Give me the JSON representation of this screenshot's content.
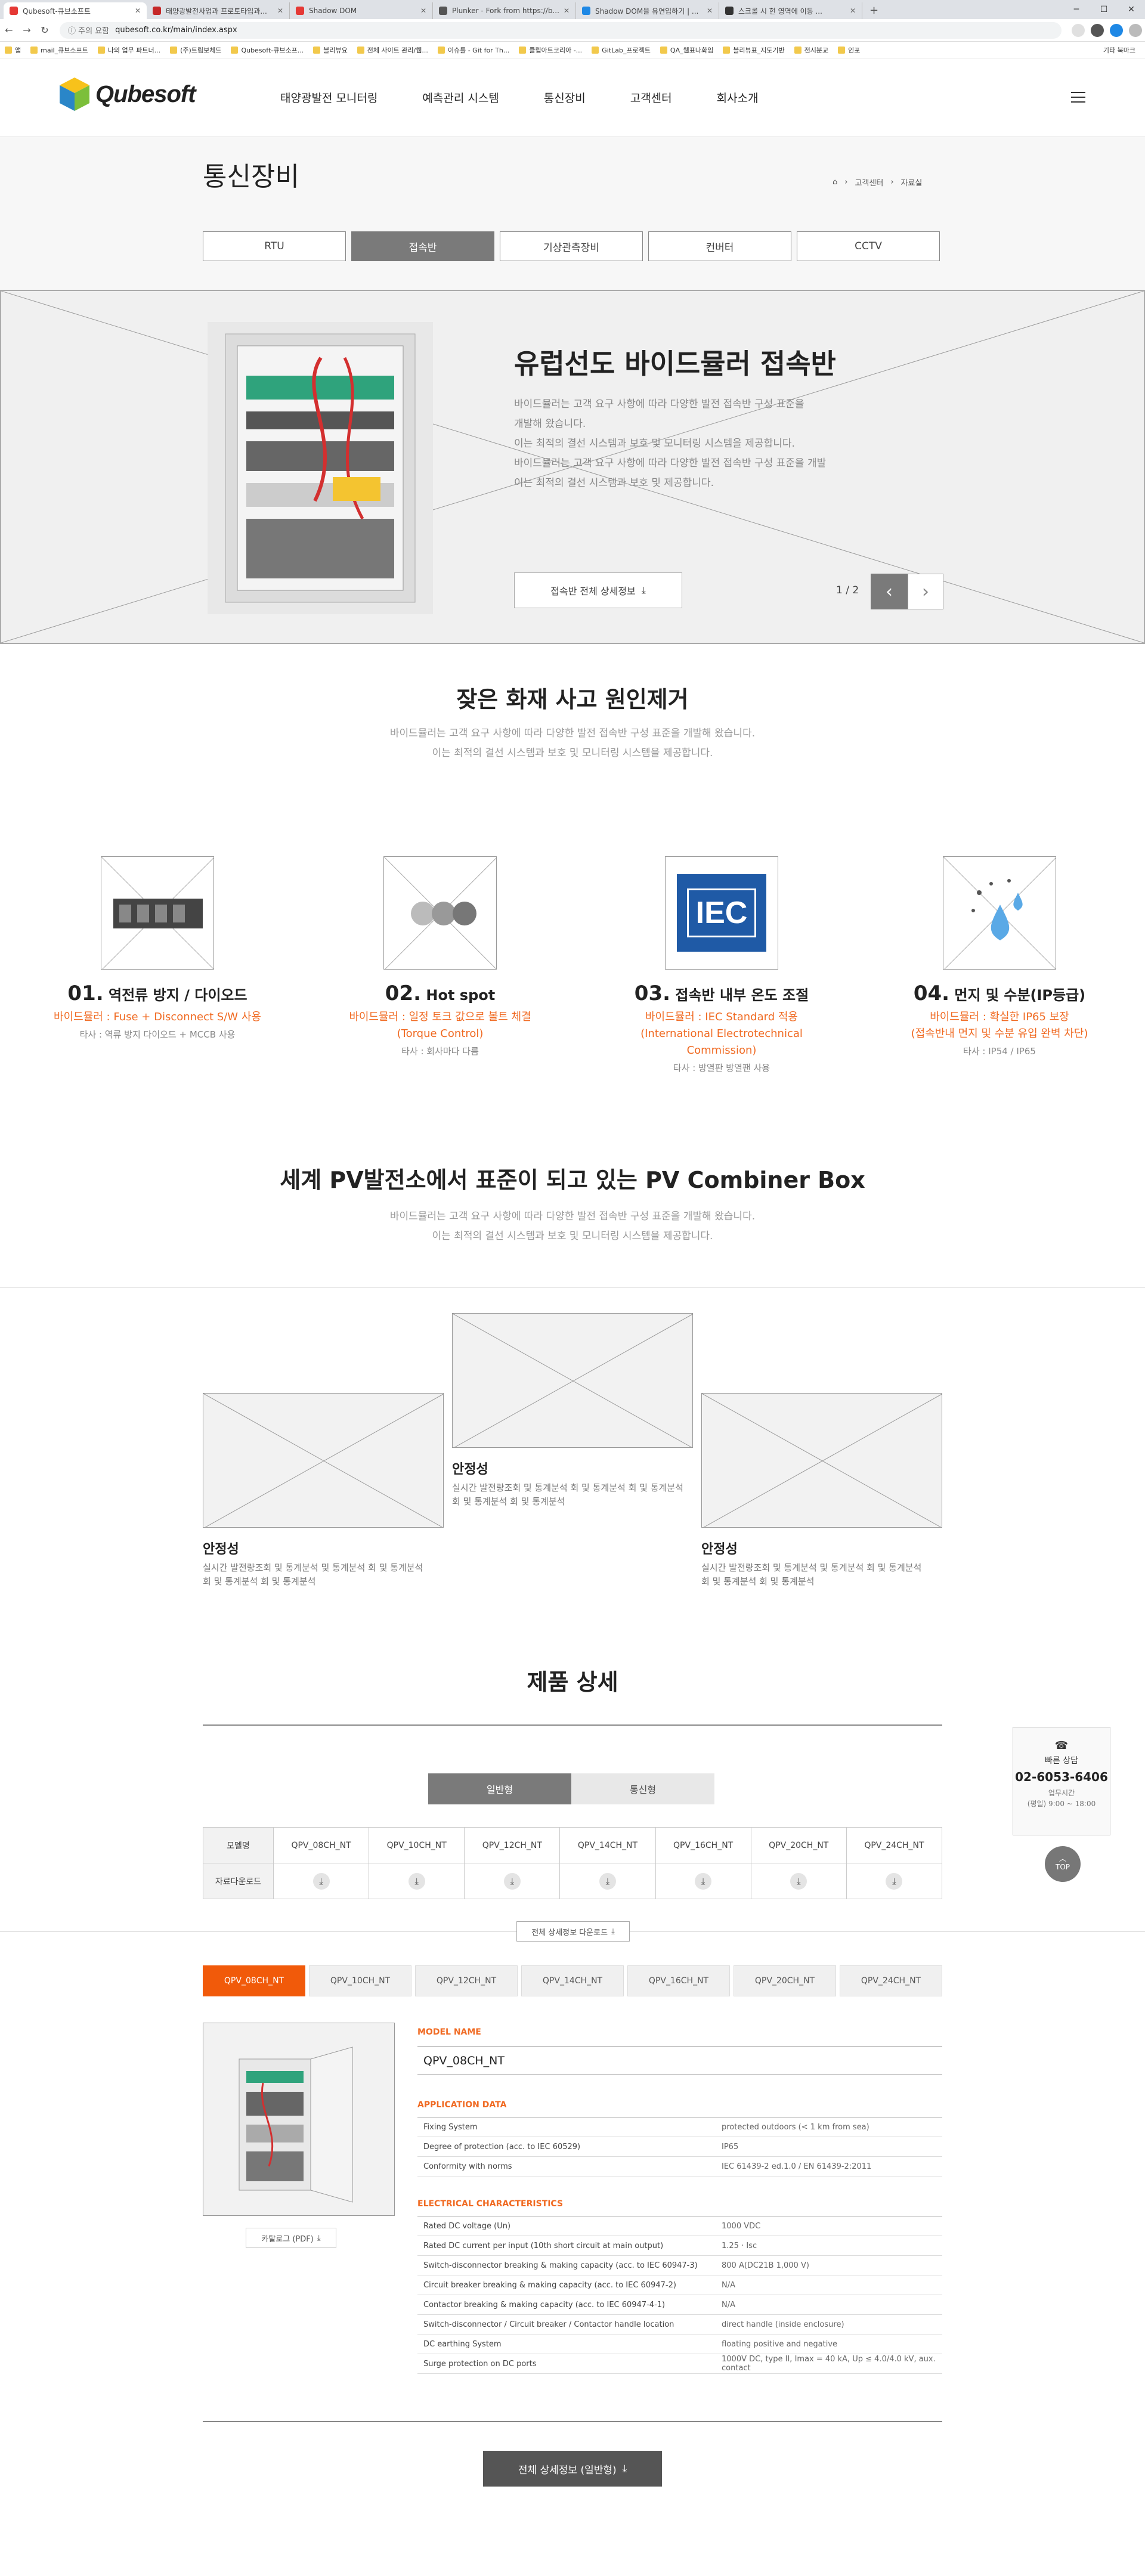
{
  "browser": {
    "tabs": [
      {
        "label": "Qubesoft-큐브소프트",
        "active": true,
        "color": "#e53935"
      },
      {
        "label": "태양광발전사업과 프로토타입과...",
        "active": false,
        "color": "#c62828"
      },
      {
        "label": "Shadow DOM",
        "active": false,
        "color": "#e53935"
      },
      {
        "label": "Plunker - Fork from https://b...",
        "active": false,
        "color": "#555555"
      },
      {
        "label": "Shadow DOM을 유연입하기 | ...",
        "active": false,
        "color": "#1e88e5"
      },
      {
        "label": "스크롤 시 현 영역에 이동 ...",
        "active": false,
        "color": "#333333"
      }
    ],
    "new_tab": "+",
    "security": "주의 요함",
    "url": "qubesoft.co.kr/main/index.aspx",
    "bookmarks": [
      "앱",
      "mail_큐브소프트",
      "나의 업무 파트너...",
      "(주)트림보체드",
      "Qubesoft-큐브소프...",
      "블리뷰요",
      "전체 사이트 관리/웹...",
      "이슈를 - Git for Th...",
      "클립아트코리아 -...",
      "GitLab_프로젝트",
      "QA_웹표나화임",
      "블리뷰표_지도기반",
      "전시분교",
      "인포"
    ],
    "other_bookmarks": "기타 북마크"
  },
  "header": {
    "logo_text": "Qubesoft",
    "nav": [
      "태양광발전 모니터링",
      "예측관리 시스템",
      "통신장비",
      "고객센터",
      "회사소개"
    ]
  },
  "subtop": {
    "title": "통신장비",
    "breadcrumb": [
      "고객센터",
      "자료실"
    ],
    "tabs": [
      "RTU",
      "접속반",
      "기상관측장비",
      "컨버터",
      "CCTV"
    ],
    "active_tab": 1
  },
  "hero": {
    "title": "유럽선도 바이드뮬러 접속반",
    "desc": [
      "바이드뮬러는 고객 요구 사항에 따라 다양한 발전 접속반 구성 표준을",
      "개발해 왔습니다.",
      "이는 최적의 결선 시스템과 보호 및 모니터링 시스템을 제공합니다.",
      "바이드뮬러는 고객 요구 사항에 따라 다양한 발전 접속반 구성 표준을 개발",
      "이는 최적의 결선 시스템과 보호 및 제공합니다."
    ],
    "button": "접속반 전체 상세정보",
    "page": "1 / 2",
    "prev": "‹",
    "next": "›"
  },
  "section1": {
    "title": "잦은 화재 사고 원인제거",
    "desc": [
      "바이드뮬러는 고객 요구 사항에 따라 다양한 발전 접속반 구성 표준을 개발해 왔습니다.",
      "이는 최적의 결선 시스템과 보호 및 모니터링 시스템을 제공합니다."
    ],
    "features": [
      {
        "num": "01.",
        "title": "역전류 방지 / 다이오드",
        "highlight": [
          "바이드뮬러 : Fuse + Disconnect S/W 사용"
        ],
        "sub": "타사 : 역류 방지 다이오드 + MCCB 사용"
      },
      {
        "num": "02.",
        "title": "Hot spot",
        "highlight": [
          "바이드뮬러 : 일정 토크 값으로 볼트 체결",
          "(Torque Control)"
        ],
        "sub": "타사 : 회사마다 다름"
      },
      {
        "num": "03.",
        "title": "접속반 내부 온도 조절",
        "highlight": [
          "바이드뮬러 : IEC Standard 적용",
          "(International Electrotechnical Commission)"
        ],
        "sub": "타사 : 방열판 방열팬 사용"
      },
      {
        "num": "04.",
        "title": "먼지 및 수분(IP등급)",
        "highlight": [
          "바이드뮬러 : 확실한 IP65 보장",
          "(접속반내 먼지 및 수분 유입 완벽 차단)"
        ],
        "sub": "타사 : IP54 / IP65"
      }
    ],
    "iec_logo": "IEC"
  },
  "section2": {
    "title": "세계 PV발전소에서 표준이 되고 있는 PV Combiner Box",
    "desc": [
      "바이드뮬러는 고객 요구 사항에 따라 다양한 발전 접속반 구성 표준을 개발해 왔습니다.",
      "이는 최적의 결선 시스템과 보호 및 모니터링 시스템을 제공합니다."
    ],
    "cards": [
      {
        "title": "안정성",
        "desc": [
          "실시간 발전량조회 및 통계분석 및 통계분석 회 및 통계분석",
          "회 및 통계분석 회 및 통계분석"
        ]
      },
      {
        "title": "안정성",
        "desc": [
          "실시간 발전량조회 및 통계분석 회 및 통계분석 회 및 통계분석",
          "회 및 통계분석 회 및 통계분석"
        ]
      },
      {
        "title": "안정성",
        "desc": [
          "실시간 발전량조회 및 통계분석 및 통계분석 회 및 통계분석",
          "회 및 통계분석 회 및 통계분석"
        ]
      }
    ]
  },
  "spec": {
    "title": "제품 상세",
    "type_tabs": [
      "일반형",
      "통신형"
    ],
    "table_row_headers": [
      "모델명",
      "자료다운로드"
    ],
    "models": [
      "QPV_08CH_NT",
      "QPV_10CH_NT",
      "QPV_12CH_NT",
      "QPV_14CH_NT",
      "QPV_16CH_NT",
      "QPV_20CH_NT",
      "QPV_24CH_NT"
    ],
    "full_download": "전체 상세정보 다운로드",
    "active_model": 0,
    "catalog_button": "카탈로그 (PDF)",
    "model_name_label": "MODEL NAME",
    "model_name": "QPV_08CH_NT",
    "app_label": "APPLICATION DATA",
    "app_rows": [
      [
        "Fixing System",
        "protected outdoors (< 1 km from sea)"
      ],
      [
        "Degree of protection (acc. to IEC 60529)",
        "IP65"
      ],
      [
        "Conformity with norms",
        "IEC 61439-2 ed.1.0 / EN 61439-2:2011"
      ]
    ],
    "elec_label": "ELECTRICAL CHARACTERISTICS",
    "elec_rows": [
      [
        "Rated DC voltage (Un)",
        "1000 VDC"
      ],
      [
        "Rated DC current per input (10th short circuit at main output)",
        "1.25 · Isc"
      ],
      [
        "Switch-disconnector breaking & making capacity (acc. to IEC 60947-3)",
        "800 A(DC21B 1,000 V)"
      ],
      [
        "Circuit breaker breaking & making capacity (acc. to IEC 60947-2)",
        "N/A"
      ],
      [
        "Contactor breaking & making capacity (acc. to IEC 60947-4-1)",
        "N/A"
      ],
      [
        "Switch-disconnector / Circuit breaker / Contactor handle location",
        "direct handle (inside enclosure)"
      ],
      [
        "DC earthing System",
        "floating positive and negative"
      ],
      [
        "Surge protection on DC ports",
        "1000V DC, type II, Imax = 40 kA, Up ≤ 4.0/4.0 kV, aux. contact"
      ]
    ],
    "bottom_button": "전체 상세정보 (일반형)"
  },
  "quick": {
    "icon": "☎",
    "label": "빠른 상담",
    "phone": "02-6053-6406",
    "hours_label": "업무시간",
    "hours": "(평일) 9:00 ~ 18:00",
    "top": "TOP"
  },
  "colors": {
    "accent": "#f06a22",
    "tab_active": "#7a7a7a",
    "iec_blue": "#1f5aa6"
  }
}
